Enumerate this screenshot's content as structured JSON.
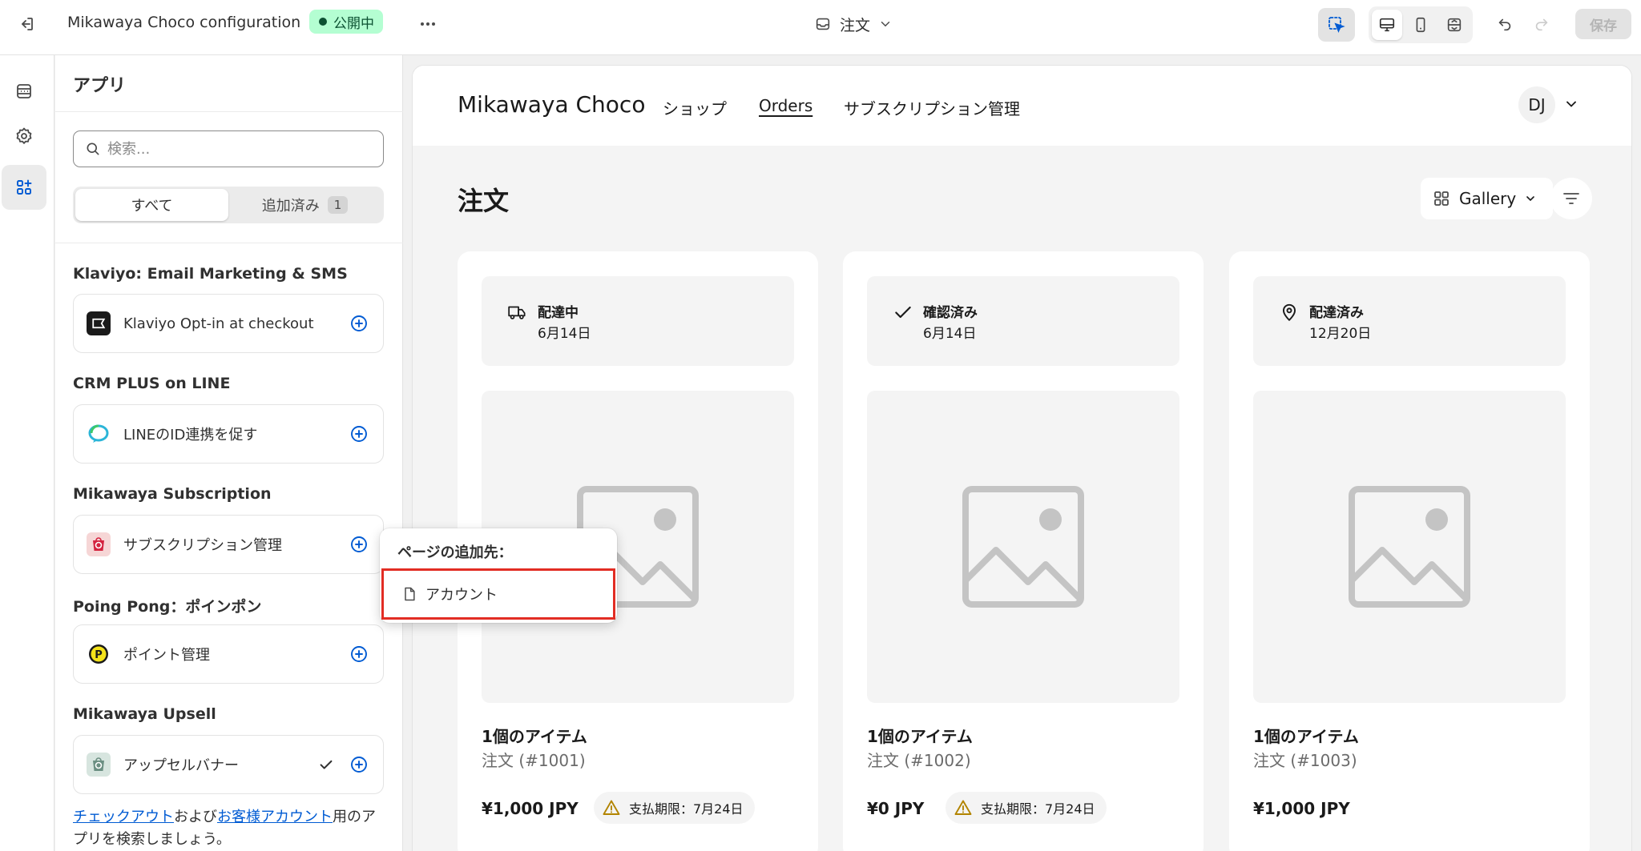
{
  "topbar": {
    "title": "Mikawaya Choco configuration",
    "status_badge": "公開中",
    "page_selector": "注文",
    "save_label": "保存"
  },
  "apps_panel": {
    "title": "アプリ",
    "search_placeholder": "検索...",
    "filter_tabs": [
      {
        "label": "すべて",
        "active": true
      },
      {
        "label": "追加済み",
        "count": "1",
        "active": false
      }
    ],
    "groups": [
      {
        "title": "Klaviyo: Email Marketing & SMS",
        "app": {
          "name": "Klaviyo Opt-in at checkout",
          "icon": "klaviyo-logo",
          "added": false
        }
      },
      {
        "title": "CRM PLUS on LINE",
        "app": {
          "name": "LINEのID連携を促す",
          "icon": "crm-plus-line-logo",
          "added": false
        }
      },
      {
        "title": "Mikawaya Subscription",
        "app": {
          "name": "サブスクリプション管理",
          "icon": "mikawaya-subscription-logo",
          "added": false
        }
      },
      {
        "title": "Poing Pong：ポインポン",
        "app": {
          "name": "ポイント管理",
          "icon": "poing-pong-logo",
          "added": false
        }
      },
      {
        "title": "Mikawaya Upsell",
        "app": {
          "name": "アップセルバナー",
          "icon": "mikawaya-upsell-logo",
          "added": true
        }
      }
    ],
    "footer": {
      "link1": "チェックアウト",
      "text1": "および",
      "link2": "お客様アカウント",
      "text2": "用のアプリを検索しましょう。"
    }
  },
  "popover": {
    "title": "ページの追加先：",
    "item": "アカウント",
    "highlight_color": "#e22d24"
  },
  "preview": {
    "brand": "Mikawaya Choco",
    "nav": [
      "ショップ",
      "Orders",
      "サブスクリプション管理"
    ],
    "nav_current": "Orders",
    "avatar_initials": "DJ",
    "heading": "注文",
    "view_selector": "Gallery",
    "orders": [
      {
        "status": "配達中",
        "status_icon": "delivery-truck-icon",
        "date": "6月14日",
        "items": "1個のアイテム",
        "number": "注文 (#1001)",
        "total": "¥1,000 JPY",
        "due": "支払期限：7月24日"
      },
      {
        "status": "確認済み",
        "status_icon": "checkmark-icon",
        "date": "6月14日",
        "items": "1個のアイテム",
        "number": "注文 (#1002)",
        "total": "¥0 JPY",
        "due": "支払期限：7月24日"
      },
      {
        "status": "配達済み",
        "status_icon": "location-pin-icon",
        "date": "12月20日",
        "items": "1個のアイテム",
        "number": "注文 (#1003)",
        "total": "¥1,000 JPY",
        "due": ""
      }
    ]
  },
  "colors": {
    "accent_blue": "#005bd3",
    "badge_green_bg": "#b4fed2",
    "badge_green_text": "#0c5132",
    "warning_icon": "#b28400"
  }
}
